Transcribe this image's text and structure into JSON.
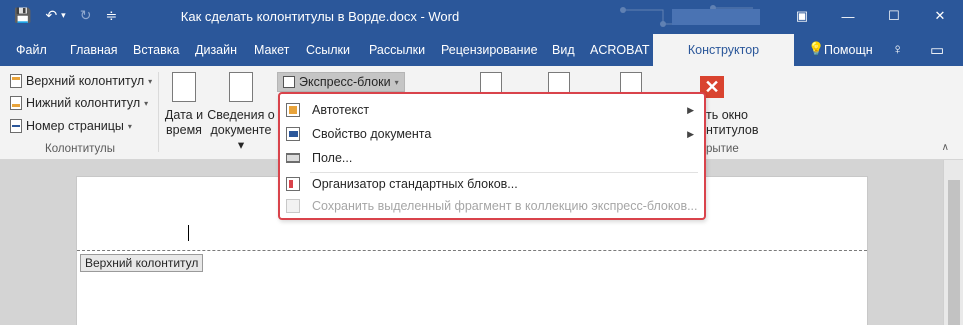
{
  "window": {
    "title": "Как сделать колонтитулы в Ворде.docx - Word",
    "qat": {
      "save_icon": "💾",
      "undo_icon": "↶",
      "undo_caret": "▾",
      "redo_icon": "↻",
      "customize_icon": "≑"
    },
    "controls": {
      "ribbon_display": "▣",
      "minimize": "—",
      "maximize": "☐",
      "close": "✕"
    }
  },
  "tabs": {
    "items": [
      "Файл",
      "Главная",
      "Вставка",
      "Дизайн",
      "Макет",
      "Ссылки",
      "Рассылки",
      "Рецензирование",
      "Вид",
      "ACROBAT"
    ],
    "active": "Конструктор",
    "tell_me": "Помощн",
    "tell_me_icon": "♀",
    "share_icon": "⚲",
    "comments_icon": "▭"
  },
  "ribbon": {
    "header_footer_group": {
      "header": "Верхний колонтитул",
      "footer": "Нижний колонтитул",
      "page_number": "Номер страницы",
      "caret": "▾",
      "label": "Колонтитулы"
    },
    "insert_group": {
      "date_time_1": "Дата и",
      "date_time_2": "время",
      "doc_info_1": "Сведения о",
      "doc_info_2": "документе ▾",
      "express_blocks": "Экспресс-блоки",
      "express_caret": "▾"
    },
    "close_group": {
      "close_icon": "✕",
      "close_text_1": "ть окно",
      "close_text_2": "нтитулов",
      "label": "рытие"
    },
    "collapse": "∧"
  },
  "menu": {
    "items": [
      {
        "label": "Автотекст",
        "has_submenu": true,
        "enabled": true
      },
      {
        "label": "Свойство документа",
        "has_submenu": true,
        "enabled": true
      },
      {
        "label": "Поле...",
        "has_submenu": false,
        "enabled": true
      },
      {
        "label": "Организатор стандартных блоков...",
        "has_submenu": false,
        "enabled": true
      },
      {
        "label": "Сохранить выделенный фрагмент в коллекцию экспресс-блоков...",
        "has_submenu": false,
        "enabled": false
      }
    ],
    "submenu_arrow": "▶",
    "highlight_color": "#d9434b"
  },
  "document": {
    "header_tag": "Верхний колонтитул"
  },
  "colors": {
    "accent": "#2b579a",
    "close_red": "#d9432f"
  }
}
